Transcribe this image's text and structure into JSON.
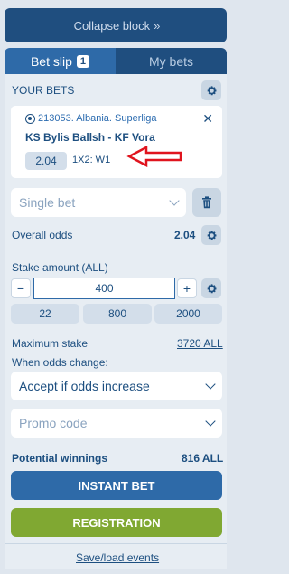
{
  "collapse": {
    "label": "Collapse block",
    "chevron": "»"
  },
  "tabs": {
    "bet_slip": "Bet slip",
    "bet_slip_count": "1",
    "my_bets": "My bets"
  },
  "your_bets": {
    "title": "YOUR BETS"
  },
  "bet": {
    "event_id": "213053. Albania. Superliga",
    "match": "KS Bylis Ballsh - KF Vora",
    "odds": "2.04",
    "type": "1X2: W1",
    "close_icon": "close-icon",
    "sport_icon": "football-icon"
  },
  "bet_mode": {
    "value": "Single bet"
  },
  "overall_odds": {
    "label": "Overall odds",
    "value": "2.04"
  },
  "stake": {
    "label": "Stake amount (ALL)",
    "value": "400",
    "minus": "−",
    "plus": "+",
    "quick": [
      "22",
      "800",
      "2000"
    ]
  },
  "max_stake": {
    "label": "Maximum stake",
    "value": "3720 ALL"
  },
  "odds_change": {
    "label": "When odds change:",
    "value": "Accept if odds increase"
  },
  "promo": {
    "placeholder": "Promo code"
  },
  "winnings": {
    "label": "Potential winnings",
    "value": "816 ALL"
  },
  "buttons": {
    "instant": "INSTANT BET",
    "registration": "REGISTRATION"
  },
  "footer": {
    "save_load": "Save/load events"
  },
  "colors": {
    "primary": "#2e6aa8",
    "dark": "#1f4e7f",
    "registration": "#80a832",
    "annotation_arrow": "#e0141e"
  }
}
